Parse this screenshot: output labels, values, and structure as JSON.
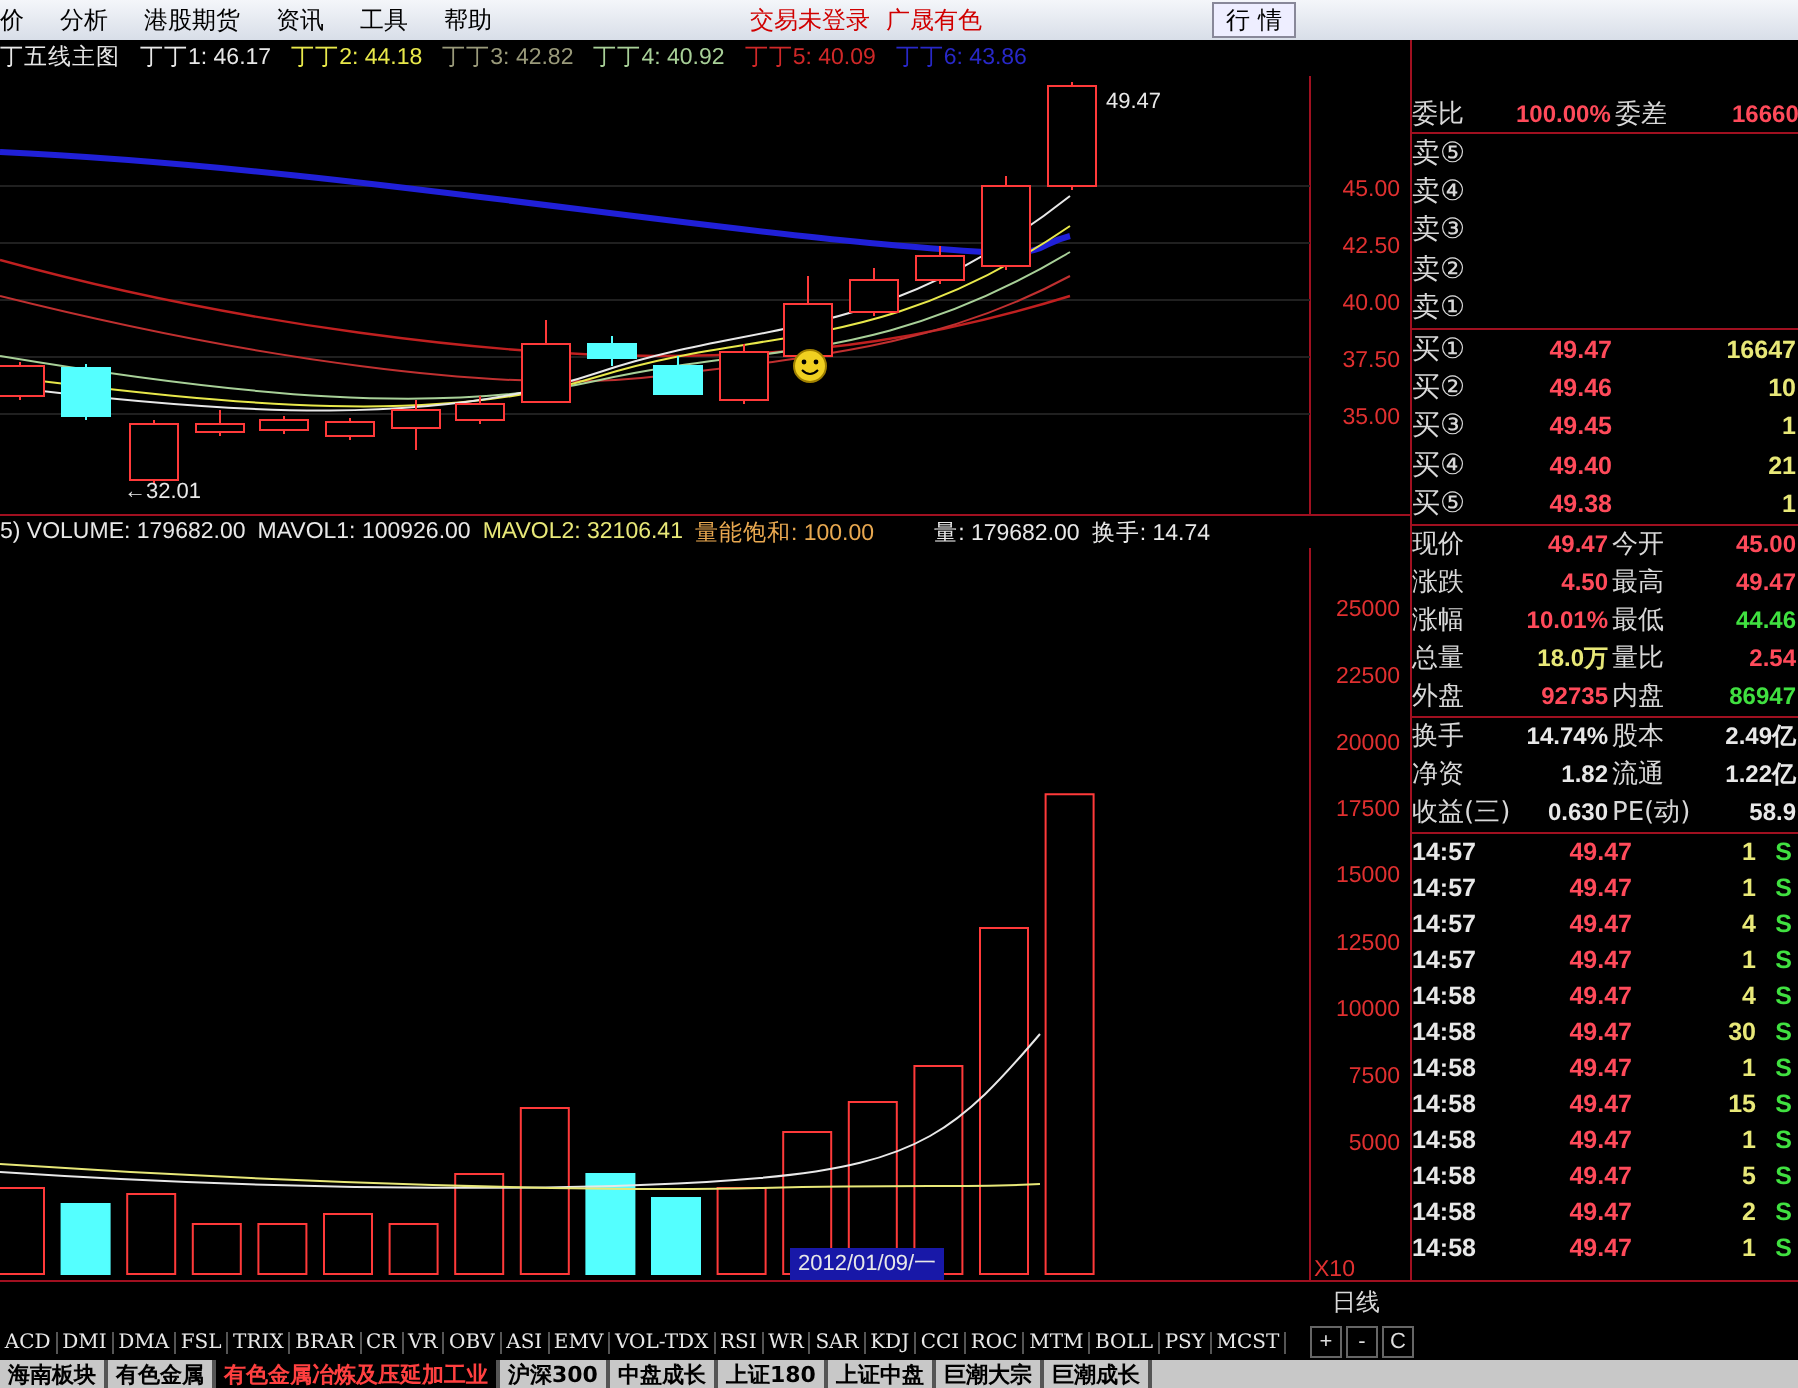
{
  "menu": {
    "items": [
      "价",
      "分析",
      "港股期货",
      "资讯",
      "工具",
      "帮助"
    ],
    "status": "交易未登录",
    "stock": "广晟有色",
    "quote_button": "行 情"
  },
  "price_chart": {
    "title": "丁五线主图",
    "indicators": [
      {
        "label": "丁丁1: 46.17",
        "color": "#e8e8e8"
      },
      {
        "label": "丁丁2: 44.18",
        "color": "#e8e84a"
      },
      {
        "label": "丁丁3: 42.82",
        "color": "#9a9a7a"
      },
      {
        "label": "丁丁4: 40.92",
        "color": "#a8d098"
      },
      {
        "label": "丁丁5: 40.09",
        "color": "#d02828"
      },
      {
        "label": "丁丁6: 43.86",
        "color": "#2828c8"
      }
    ],
    "axis_labels": [
      "45.00",
      "42.50",
      "40.00",
      "37.50",
      "35.00"
    ],
    "high_label": "49.47",
    "low_label": "←32.01"
  },
  "volume_chart": {
    "indicators": [
      {
        "label": "5) VOLUME: 179682.00",
        "color": "#e8e8e8"
      },
      {
        "label": "MAVOL1: 100926.00",
        "color": "#e8e8e8"
      },
      {
        "label": "MAVOL2: 32106.41",
        "color": "#e8e878"
      },
      {
        "label": "量能饱和: 100.00",
        "color": "#e8a850"
      },
      {
        "label": "量: 179682.00",
        "color": "#e8e8e8"
      },
      {
        "label": "换手: 14.74",
        "color": "#e8e8e8"
      }
    ],
    "axis_labels": [
      "25000",
      "22500",
      "20000",
      "17500",
      "15000",
      "12500",
      "10000",
      "7500",
      "5000"
    ],
    "axis_multiplier": "X10",
    "date_label": "2012/01/09/一"
  },
  "quote": {
    "ratio_row": [
      {
        "label": "委比",
        "value": "100.00%",
        "color": "#ff4a5a"
      },
      {
        "label": "委差",
        "value": "16660",
        "color": "#ff4a5a"
      }
    ],
    "sells": [
      {
        "label": "卖⑤"
      },
      {
        "label": "卖④"
      },
      {
        "label": "卖③"
      },
      {
        "label": "卖②"
      },
      {
        "label": "卖①"
      }
    ],
    "buys": [
      {
        "label": "买①",
        "price": "49.47",
        "volume": "16647"
      },
      {
        "label": "买②",
        "price": "49.46",
        "volume": "10"
      },
      {
        "label": "买③",
        "price": "49.45",
        "volume": "1"
      },
      {
        "label": "买④",
        "price": "49.40",
        "volume": "21"
      },
      {
        "label": "买⑤",
        "price": "49.38",
        "volume": "1"
      }
    ],
    "stats": [
      {
        "label": "现价",
        "value": "49.47",
        "color": "#ff4a5a"
      },
      {
        "label": "今开",
        "value": "45.00",
        "color": "#ff4a5a"
      },
      {
        "label": "涨跌",
        "value": "4.50",
        "color": "#ff4a5a"
      },
      {
        "label": "最高",
        "value": "49.47",
        "color": "#ff4a5a"
      },
      {
        "label": "涨幅",
        "value": "10.01%",
        "color": "#ff4a5a"
      },
      {
        "label": "最低",
        "value": "44.46",
        "color": "#40e040"
      },
      {
        "label": "总量",
        "value": "18.0万",
        "color": "#e8e878"
      },
      {
        "label": "量比",
        "value": "2.54",
        "color": "#ff4a5a"
      },
      {
        "label": "外盘",
        "value": "92735",
        "color": "#ff4a5a"
      },
      {
        "label": "内盘",
        "value": "86947",
        "color": "#40e040"
      }
    ],
    "info": [
      {
        "label": "换手",
        "value": "14.74%"
      },
      {
        "label": "股本",
        "value": "2.49亿"
      },
      {
        "label": "净资",
        "value": "1.82"
      },
      {
        "label": "流通",
        "value": "1.22亿"
      },
      {
        "label": "收益(三)",
        "value": "0.630"
      },
      {
        "label": "PE(动)",
        "value": "58.9"
      }
    ],
    "ticks": [
      {
        "time": "14:57",
        "price": "49.47",
        "volume": "1",
        "side": "S"
      },
      {
        "time": "14:57",
        "price": "49.47",
        "volume": "1",
        "side": "S"
      },
      {
        "time": "14:57",
        "price": "49.47",
        "volume": "4",
        "side": "S"
      },
      {
        "time": "14:57",
        "price": "49.47",
        "volume": "1",
        "side": "S"
      },
      {
        "time": "14:58",
        "price": "49.47",
        "volume": "4",
        "side": "S"
      },
      {
        "time": "14:58",
        "price": "49.47",
        "volume": "30",
        "side": "S"
      },
      {
        "time": "14:58",
        "price": "49.47",
        "volume": "1",
        "side": "S"
      },
      {
        "time": "14:58",
        "price": "49.47",
        "volume": "15",
        "side": "S"
      },
      {
        "time": "14:58",
        "price": "49.47",
        "volume": "1",
        "side": "S"
      },
      {
        "time": "14:58",
        "price": "49.47",
        "volume": "5",
        "side": "S"
      },
      {
        "time": "14:58",
        "price": "49.47",
        "volume": "2",
        "side": "S"
      },
      {
        "time": "14:58",
        "price": "49.47",
        "volume": "1",
        "side": "S"
      }
    ]
  },
  "period": "日线",
  "zoom_buttons": [
    "+",
    "-",
    "C"
  ],
  "indicator_tabs": [
    "ACD",
    "DMI",
    "DMA",
    "FSL",
    "TRIX",
    "BRAR",
    "CR",
    "VR",
    "OBV",
    "ASI",
    "EMV",
    "VOL-TDX",
    "RSI",
    "WR",
    "SAR",
    "KDJ",
    "CCI",
    "ROC",
    "MTM",
    "BOLL",
    "PSY",
    "MCST"
  ],
  "sector_tabs": [
    {
      "label": "海南板块",
      "selected": false
    },
    {
      "label": "有色金属",
      "selected": false
    },
    {
      "label": "有色金属冶炼及压延加工业",
      "selected": true
    },
    {
      "label": "沪深300",
      "selected": false
    },
    {
      "label": "中盘成长",
      "selected": false
    },
    {
      "label": "上证180",
      "selected": false
    },
    {
      "label": "上证中盘",
      "selected": false
    },
    {
      "label": "巨潮大宗",
      "selected": false
    },
    {
      "label": "巨潮成长",
      "selected": false
    }
  ]
}
